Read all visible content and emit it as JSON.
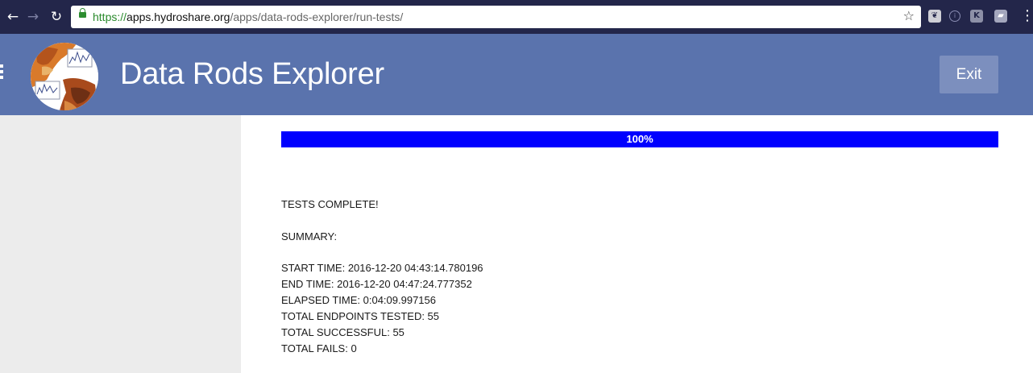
{
  "browser": {
    "url_scheme": "https://",
    "url_host": "apps.hydroshare.org",
    "url_path": "/apps/data-rods-explorer/run-tests/"
  },
  "app": {
    "title": "Data Rods Explorer",
    "exit_label": "Exit"
  },
  "progress": {
    "value": 100,
    "label": "100%"
  },
  "results": {
    "status": "TESTS COMPLETE!",
    "summary_heading": "SUMMARY:",
    "lines": [
      "START TIME: 2016-12-20 04:43:14.780196",
      "END TIME: 2016-12-20 04:47:24.777352",
      "ELAPSED TIME: 0:04:09.997156",
      "TOTAL ENDPOINTS TESTED: 55",
      "TOTAL SUCCESSFUL: 55",
      "TOTAL FAILS: 0"
    ]
  },
  "colors": {
    "header_bg": "#5a73ad",
    "progress_fill": "#0000ff",
    "sidebar_bg": "#ececec",
    "chrome_bg": "#23264a"
  }
}
